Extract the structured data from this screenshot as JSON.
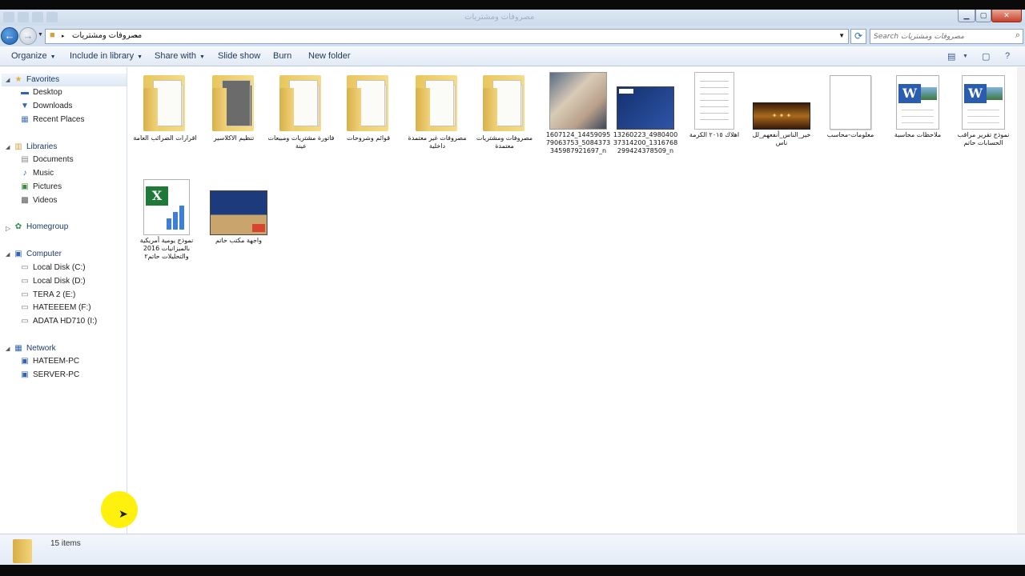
{
  "window": {
    "title_faint": "مصروفات ومشتريات"
  },
  "address": {
    "crumbs": [
      "مصروفات ومشتريات"
    ],
    "search_placeholder": "Search مصروفات ومشتريات"
  },
  "toolbar": {
    "organize": "Organize",
    "include_in_library": "Include in library",
    "share_with": "Share with",
    "slide_show": "Slide show",
    "burn": "Burn",
    "new_folder": "New folder"
  },
  "nav": {
    "favorites": "Favorites",
    "desktop": "Desktop",
    "downloads": "Downloads",
    "recent_places": "Recent Places",
    "libraries": "Libraries",
    "documents": "Documents",
    "music": "Music",
    "pictures": "Pictures",
    "videos": "Videos",
    "homegroup": "Homegroup",
    "computer": "Computer",
    "local_c": "Local Disk (C:)",
    "local_d": "Local Disk (D:)",
    "tera_e": "TERA 2 (E:)",
    "hateeem_f": "HATEEEEM (F:)",
    "adata_i": "ADATA HD710 (I:)",
    "network": "Network",
    "hateem_pc": "HATEEM-PC",
    "server_pc": "SERVER-PC"
  },
  "items": [
    {
      "label": "اقرارات الضرائب العامة",
      "kind": "folder"
    },
    {
      "label": "تنظيم الاكلاسير",
      "kind": "folder"
    },
    {
      "label": "فاتورة مشتريات ومبيعات عينة",
      "kind": "folder"
    },
    {
      "label": "قوائم وشروحات",
      "kind": "folder"
    },
    {
      "label": "مصروفات غير معتمدة داخلية",
      "kind": "folder"
    },
    {
      "label": "مصروفات ومشتريات معتمدة",
      "kind": "folder"
    },
    {
      "label": "1607124_1445909579063753_5084373345987921697_n",
      "kind": "photo"
    },
    {
      "label": "13260223_498040037314200_1316768299424378509_n",
      "kind": "image"
    },
    {
      "label": "اهلاك ٢٠١٥ الكرمة",
      "kind": "document"
    },
    {
      "label": "خير_الناس_أنفعهم_لل ناس",
      "kind": "image"
    },
    {
      "label": "معلومات-محاسب",
      "kind": "file"
    },
    {
      "label": "ملاحظات محاسبة",
      "kind": "word"
    },
    {
      "label": "نموذج تقرير مراقب الحسابات حاتم",
      "kind": "word"
    },
    {
      "label": "نموذج يومية أمريكية بالميزانيات 2016 والتحليلات حاتم٢",
      "kind": "excel"
    },
    {
      "label": "واجهة مكتب حاتم",
      "kind": "image"
    }
  ],
  "status": {
    "count": "15 items"
  }
}
